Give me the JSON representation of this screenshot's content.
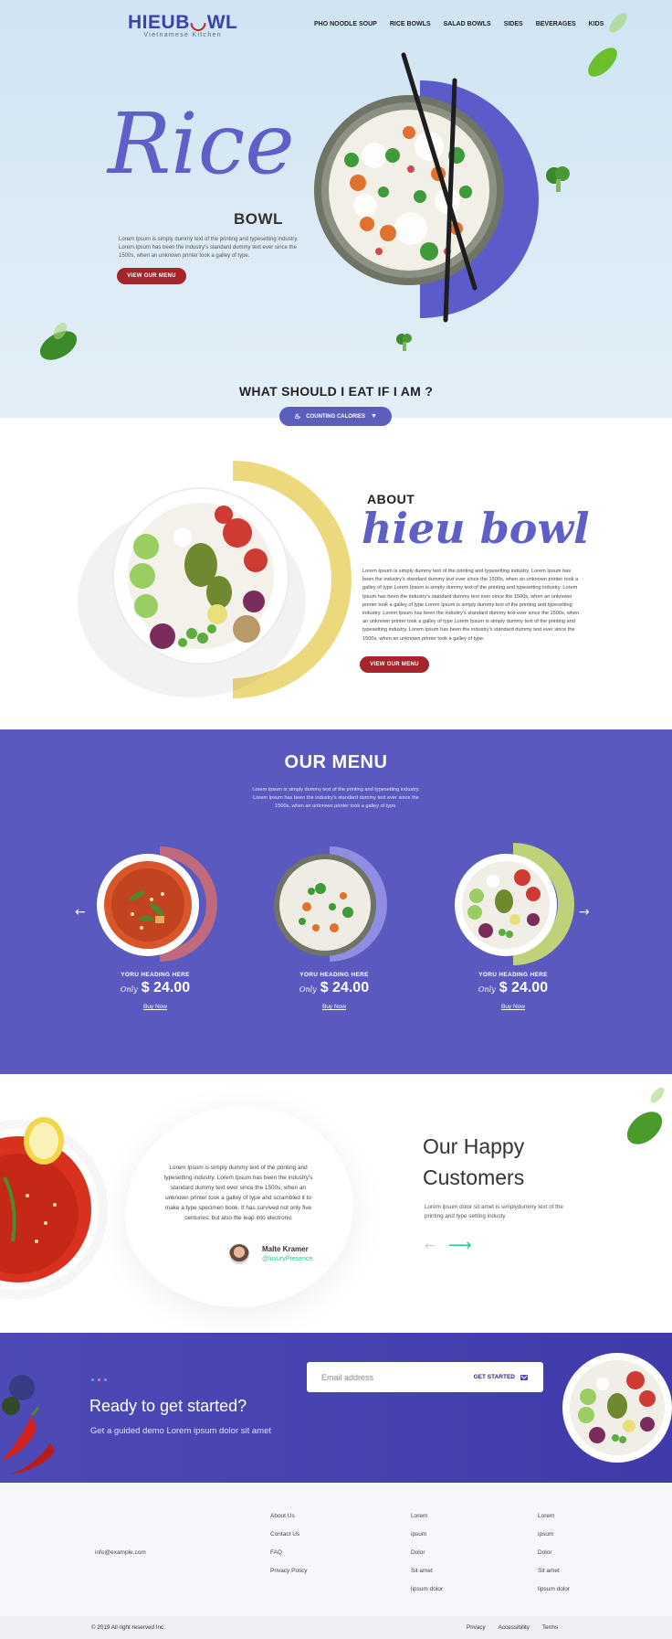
{
  "brand": {
    "name_part1": "HIEU",
    "name_part2": "B",
    "name_part3": "WL",
    "tagline": "Vietnamese Kitchen"
  },
  "nav": [
    "PHO NOODLE SOUP",
    "RICE BOWLS",
    "SALAD BOWLS",
    "SIDES",
    "BEVERAGES",
    "KIDS"
  ],
  "hero": {
    "script_title": "Rice",
    "subtitle": "BOWL",
    "text": "Lorem Ipsum is simply dummy text of the printing and typesetting industry. Lorem Ipsum has been the industry's standard dummy text ever since the 1500s, when an unknown printer took a galley of type.",
    "button": "VIEW OUR MENU",
    "question": "WHAT SHOULD I EAT  IF I AM ?",
    "pill": "COUNTING CALORIES"
  },
  "about": {
    "label": "ABOUT",
    "script_title": "hieu bowl",
    "text": "Lorem Ipsum is simply dummy text of the printing and typesetting industry. Lorem Ipsum has been the industry's standard dummy text ever since the 1500s, when an unknown printer took a galley of type Lorem Ipsum is simply dummy text of the printing and typesetting industry. Lorem Ipsum has been the industry's standard dummy text ever since the 1500s, when an unknown printer took a galley of type Lorem Ipsum is simply dummy text of the printing and typesetting industry. Lorem Ipsum has been the industry's standard dummy text ever since the 1500s, when an unknown printer took a galley of type Lorem Ipsum is simply dummy text of the printing and typesetting industry. Lorem Ipsum has been the industry's standard dummy text ever since the 1500s, when an unknown printer took a galley of type.",
    "button": "VIEW OUR MENU"
  },
  "menu": {
    "title": "OUR MENU",
    "text": "Lorem Ipsum is simply dummy text of the printing and typesetting industry. Lorem Ipsum has been the industry's standard dummy text ever since the 1500s, when an unknown printer took a galley of type.",
    "cards": [
      {
        "heading": "YORU HEADING HERE",
        "only": "Only",
        "price": "$ 24.00",
        "buy": "Buy Now",
        "arc_color": "#c16a7e"
      },
      {
        "heading": "YORU HEADING HERE",
        "only": "Only",
        "price": "$ 24.00",
        "buy": "Buy Now",
        "arc_color": "#8f8ee2"
      },
      {
        "heading": "YORU HEADING HERE",
        "only": "Only",
        "price": "$ 24.00",
        "buy": "Buy Now",
        "arc_color": "#bfd27a"
      }
    ],
    "prev": "←",
    "next": "→"
  },
  "testimonial": {
    "quote": "Lorem Ipsum is simply dummy text of the printing and typesetting industry. Lorem Ipsum has been the industry's standard dummy text ever since the 1500s, when an unknown printer took a galley of type and scrambled it to make a type specimen book. It has survived not only five centuries, but also the leap into electronic",
    "author": "Malte Kramer",
    "handle": "@luxuryPresence",
    "title_line1": "Our Happy",
    "title_line2": "Customers",
    "text": "Lorem ipsum dolor sit amet is simplydummy text of the printing and type setting industy",
    "prev": "←",
    "next": "⟶"
  },
  "cta": {
    "title": "Ready to get started?",
    "subtitle": "Get a guided demo Lorem ipsum dolor sit amet",
    "email_placeholder": "Email address",
    "button": "GET STARTED"
  },
  "footer": {
    "email": "info@example.com",
    "col1": [
      "About Us",
      "Contact Us",
      "FAQ",
      "Privacy Policy"
    ],
    "col2": [
      "Lorem",
      "ipsum",
      "Dolor",
      "Sit amet",
      "lipsum dolor"
    ],
    "col3": [
      "Lorem",
      "ipsum",
      "Dolor",
      "Sit amet",
      "lipsum dolor"
    ],
    "copyright": "© 2019 All right reserved Inc.",
    "legal": [
      "Privacy",
      "Accessibility",
      "Terms"
    ]
  },
  "colors": {
    "brand_purple": "#5a59c0",
    "accent_red": "#a4262c",
    "hero_bg": "#d4e7f5",
    "about_arc": "#ecd97d",
    "cta_bg": "#4541b0",
    "teal": "#1fc9a0"
  },
  "icons": [
    "chopsticks-icon",
    "flame-icon",
    "chevron-down-icon",
    "arrow-left-icon",
    "arrow-right-icon",
    "send-icon",
    "leaf-icon",
    "broccoli-icon",
    "chili-icon"
  ]
}
